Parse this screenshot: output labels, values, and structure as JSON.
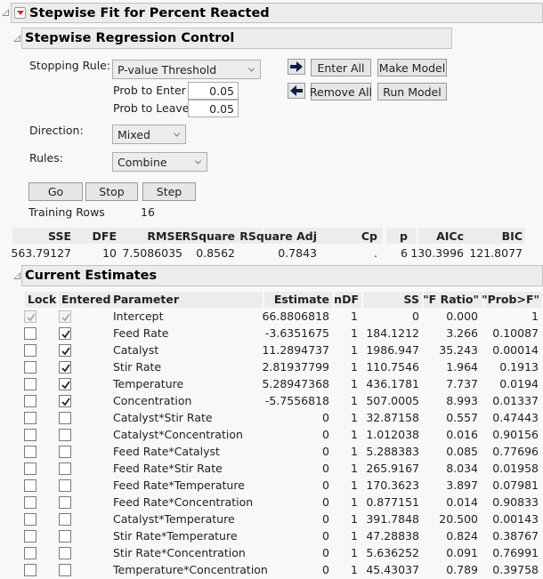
{
  "report": {
    "title": "Stepwise Fit for Percent Reacted",
    "control": {
      "title": "Stepwise Regression Control",
      "stopping_rule_label": "Stopping Rule:",
      "stopping_rule_value": "P-value Threshold",
      "prob_enter_label": "Prob to Enter",
      "prob_enter_value": "0.05",
      "prob_leave_label": "Prob to Leave",
      "prob_leave_value": "0.05",
      "direction_label": "Direction:",
      "direction_value": "Mixed",
      "rules_label": "Rules:",
      "rules_value": "Combine",
      "buttons": {
        "enter_all": "Enter All",
        "make_model": "Make Model",
        "remove_all": "Remove All",
        "run_model": "Run Model",
        "go": "Go",
        "stop": "Stop",
        "step": "Step"
      },
      "training_rows_label": "Training Rows",
      "training_rows_value": "16"
    },
    "stats": {
      "headers": [
        "SSE",
        "DFE",
        "RMSE",
        "RSquare",
        "RSquare Adj",
        "Cp",
        "p",
        "AICc",
        "BIC"
      ],
      "values": [
        "563.79127",
        "10",
        "7.5086035",
        "0.8562",
        "0.7843",
        ".",
        "6",
        "130.3996",
        "121.8077"
      ]
    },
    "estimates": {
      "title": "Current Estimates",
      "headers": [
        "Lock",
        "Entered",
        "Parameter",
        "Estimate",
        "nDF",
        "SS",
        "\"F Ratio\"",
        "\"Prob>F\""
      ],
      "rows": [
        {
          "lock": true,
          "entered": true,
          "disabled": true,
          "parameter": "Intercept",
          "estimate": "66.8806818",
          "ndf": "1",
          "ss": "0",
          "f": "0.000",
          "p": "1"
        },
        {
          "lock": false,
          "entered": true,
          "disabled": false,
          "parameter": "Feed Rate",
          "estimate": "-3.6351675",
          "ndf": "1",
          "ss": "184.1212",
          "f": "3.266",
          "p": "0.10087"
        },
        {
          "lock": false,
          "entered": true,
          "disabled": false,
          "parameter": "Catalyst",
          "estimate": "11.2894737",
          "ndf": "1",
          "ss": "1986.947",
          "f": "35.243",
          "p": "0.00014"
        },
        {
          "lock": false,
          "entered": true,
          "disabled": false,
          "parameter": "Stir Rate",
          "estimate": "2.81937799",
          "ndf": "1",
          "ss": "110.7546",
          "f": "1.964",
          "p": "0.1913"
        },
        {
          "lock": false,
          "entered": true,
          "disabled": false,
          "parameter": "Temperature",
          "estimate": "5.28947368",
          "ndf": "1",
          "ss": "436.1781",
          "f": "7.737",
          "p": "0.0194"
        },
        {
          "lock": false,
          "entered": true,
          "disabled": false,
          "parameter": "Concentration",
          "estimate": "-5.7556818",
          "ndf": "1",
          "ss": "507.0005",
          "f": "8.993",
          "p": "0.01337"
        },
        {
          "lock": false,
          "entered": false,
          "disabled": false,
          "parameter": "Catalyst*Stir Rate",
          "estimate": "0",
          "ndf": "1",
          "ss": "32.87158",
          "f": "0.557",
          "p": "0.47443"
        },
        {
          "lock": false,
          "entered": false,
          "disabled": false,
          "parameter": "Catalyst*Concentration",
          "estimate": "0",
          "ndf": "1",
          "ss": "1.012038",
          "f": "0.016",
          "p": "0.90156"
        },
        {
          "lock": false,
          "entered": false,
          "disabled": false,
          "parameter": "Feed Rate*Catalyst",
          "estimate": "0",
          "ndf": "1",
          "ss": "5.288383",
          "f": "0.085",
          "p": "0.77696"
        },
        {
          "lock": false,
          "entered": false,
          "disabled": false,
          "parameter": "Feed Rate*Stir Rate",
          "estimate": "0",
          "ndf": "1",
          "ss": "265.9167",
          "f": "8.034",
          "p": "0.01958"
        },
        {
          "lock": false,
          "entered": false,
          "disabled": false,
          "parameter": "Feed Rate*Temperature",
          "estimate": "0",
          "ndf": "1",
          "ss": "170.3623",
          "f": "3.897",
          "p": "0.07981"
        },
        {
          "lock": false,
          "entered": false,
          "disabled": false,
          "parameter": "Feed Rate*Concentration",
          "estimate": "0",
          "ndf": "1",
          "ss": "0.877151",
          "f": "0.014",
          "p": "0.90833"
        },
        {
          "lock": false,
          "entered": false,
          "disabled": false,
          "parameter": "Catalyst*Temperature",
          "estimate": "0",
          "ndf": "1",
          "ss": "391.7848",
          "f": "20.500",
          "p": "0.00143"
        },
        {
          "lock": false,
          "entered": false,
          "disabled": false,
          "parameter": "Stir Rate*Temperature",
          "estimate": "0",
          "ndf": "1",
          "ss": "47.28838",
          "f": "0.824",
          "p": "0.38767"
        },
        {
          "lock": false,
          "entered": false,
          "disabled": false,
          "parameter": "Stir Rate*Concentration",
          "estimate": "0",
          "ndf": "1",
          "ss": "5.636252",
          "f": "0.091",
          "p": "0.76991"
        },
        {
          "lock": false,
          "entered": false,
          "disabled": false,
          "parameter": "Temperature*Concentration",
          "estimate": "0",
          "ndf": "1",
          "ss": "45.43037",
          "f": "0.789",
          "p": "0.39758"
        }
      ]
    }
  },
  "colors": {
    "menu_red": "#d9232a",
    "arrow_navy": "#0d1e4a"
  }
}
